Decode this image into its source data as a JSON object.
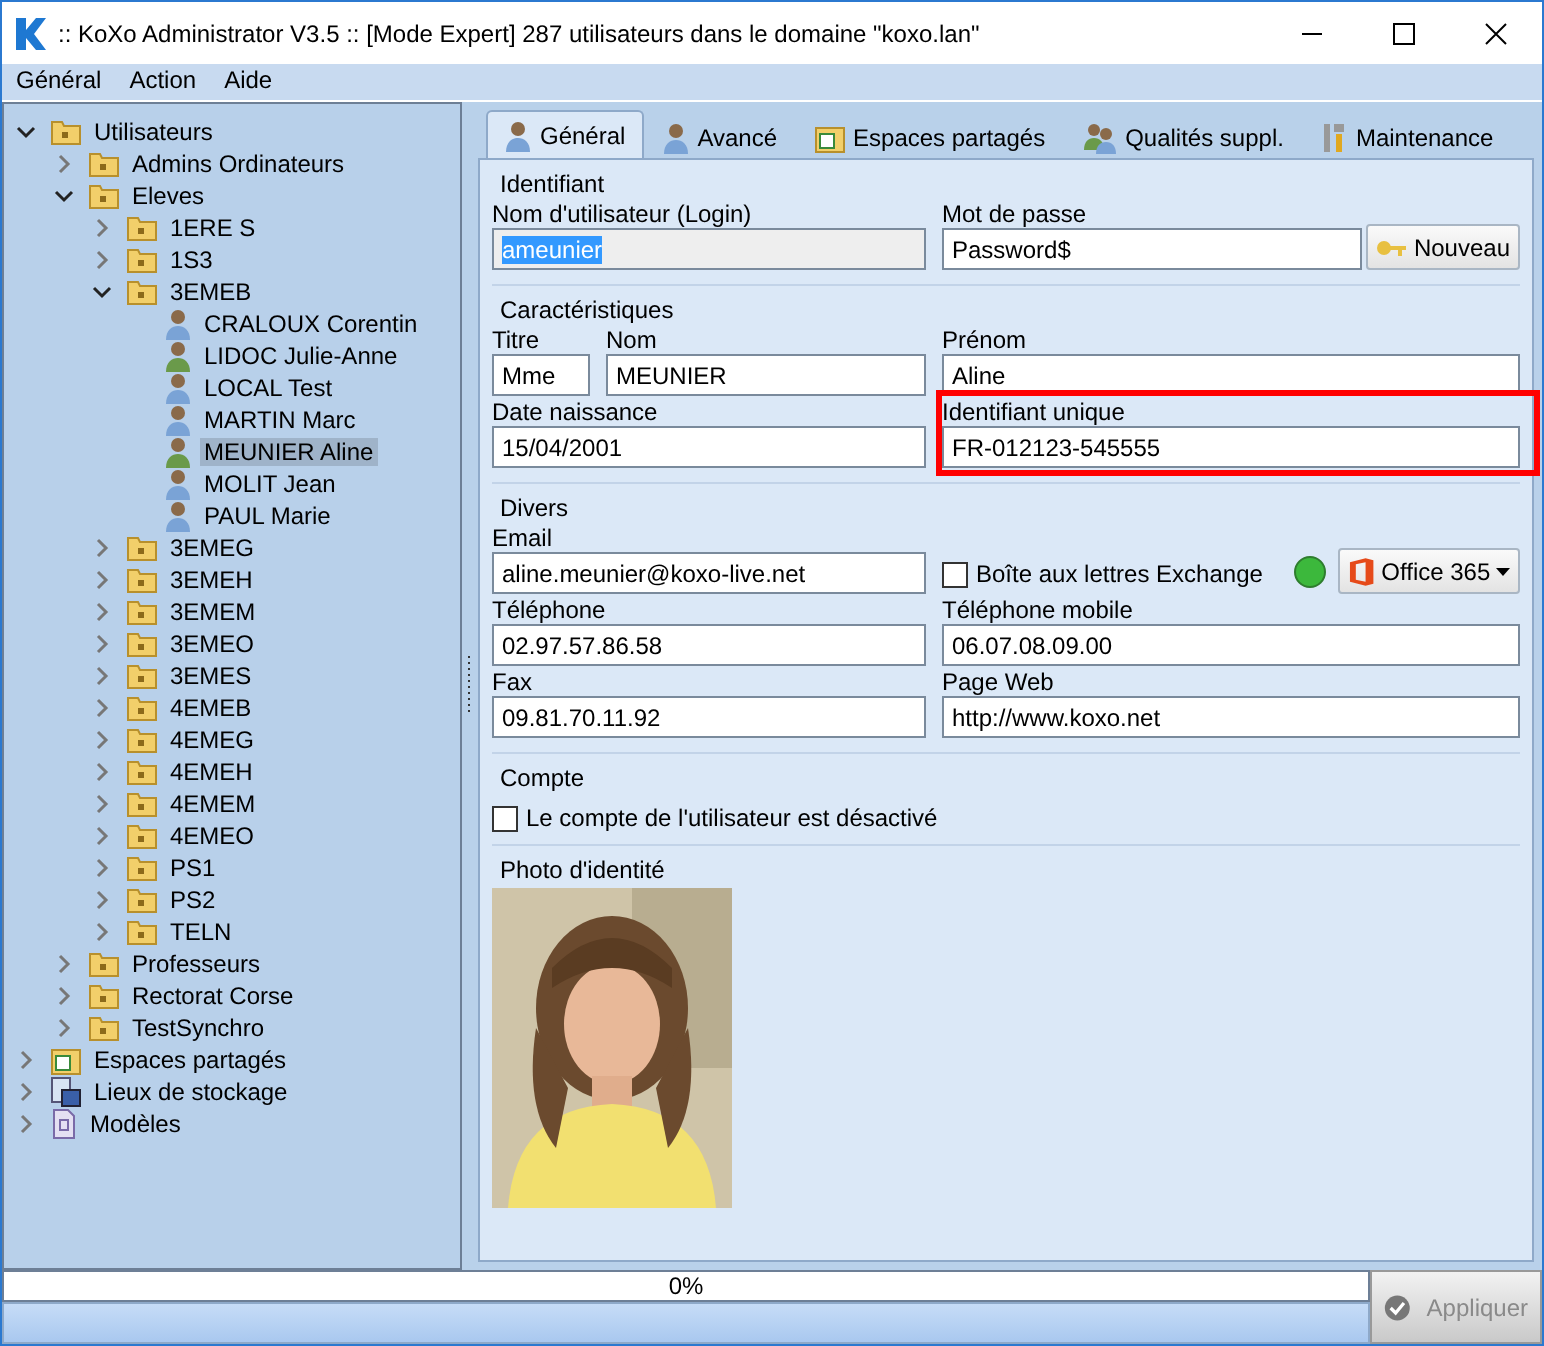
{
  "window": {
    "title": ":: KoXo Administrator V3.5 :: [Mode Expert] 287 utilisateurs dans le domaine \"koxo.lan\""
  },
  "menu": [
    {
      "label": "Général"
    },
    {
      "label": "Action"
    },
    {
      "label": "Aide"
    }
  ],
  "tree": [
    {
      "label": "Utilisateurs",
      "kind": "folder",
      "expanded": true,
      "selected": false,
      "children": [
        {
          "label": "Admins Ordinateurs",
          "kind": "folder",
          "expanded": false,
          "selected": false
        },
        {
          "label": "Eleves",
          "kind": "folder",
          "expanded": true,
          "selected": false,
          "children": [
            {
              "label": "1ERE S",
              "kind": "folder",
              "expanded": false,
              "selected": false
            },
            {
              "label": "1S3",
              "kind": "folder",
              "expanded": false,
              "selected": false
            },
            {
              "label": "3EMEB",
              "kind": "folder",
              "expanded": true,
              "selected": false,
              "children": [
                {
                  "label": "CRALOUX Corentin",
                  "kind": "user_male",
                  "selected": false
                },
                {
                  "label": "LIDOC Julie-Anne",
                  "kind": "user_female",
                  "selected": false
                },
                {
                  "label": "LOCAL Test",
                  "kind": "user_male",
                  "selected": false
                },
                {
                  "label": "MARTIN Marc",
                  "kind": "user_male",
                  "selected": false
                },
                {
                  "label": "MEUNIER Aline",
                  "kind": "user_female",
                  "selected": true
                },
                {
                  "label": "MOLIT Jean",
                  "kind": "user_male",
                  "selected": false
                },
                {
                  "label": "PAUL Marie",
                  "kind": "user_male",
                  "selected": false
                }
              ]
            },
            {
              "label": "3EMEG",
              "kind": "folder",
              "expanded": false,
              "selected": false
            },
            {
              "label": "3EMEH",
              "kind": "folder",
              "expanded": false,
              "selected": false
            },
            {
              "label": "3EMEM",
              "kind": "folder",
              "expanded": false,
              "selected": false
            },
            {
              "label": "3EMEO",
              "kind": "folder",
              "expanded": false,
              "selected": false
            },
            {
              "label": "3EMES",
              "kind": "folder",
              "expanded": false,
              "selected": false
            },
            {
              "label": "4EMEB",
              "kind": "folder",
              "expanded": false,
              "selected": false
            },
            {
              "label": "4EMEG",
              "kind": "folder",
              "expanded": false,
              "selected": false
            },
            {
              "label": "4EMEH",
              "kind": "folder",
              "expanded": false,
              "selected": false
            },
            {
              "label": "4EMEM",
              "kind": "folder",
              "expanded": false,
              "selected": false
            },
            {
              "label": "4EMEO",
              "kind": "folder",
              "expanded": false,
              "selected": false
            },
            {
              "label": "PS1",
              "kind": "folder",
              "expanded": false,
              "selected": false
            },
            {
              "label": "PS2",
              "kind": "folder",
              "expanded": false,
              "selected": false
            },
            {
              "label": "TELN",
              "kind": "folder",
              "expanded": false,
              "selected": false
            }
          ]
        },
        {
          "label": "Professeurs",
          "kind": "folder",
          "expanded": false,
          "selected": false
        },
        {
          "label": "Rectorat Corse",
          "kind": "folder",
          "expanded": false,
          "selected": false
        },
        {
          "label": "TestSynchro",
          "kind": "folder",
          "expanded": false,
          "selected": false
        }
      ]
    },
    {
      "label": "Espaces partagés",
      "kind": "shares",
      "expanded": false,
      "selected": false
    },
    {
      "label": "Lieux de stockage",
      "kind": "storage",
      "expanded": false,
      "selected": false
    },
    {
      "label": "Modèles",
      "kind": "templates",
      "expanded": false,
      "selected": false
    }
  ],
  "tabs": [
    {
      "label": "Général",
      "kind": "user",
      "selected": true
    },
    {
      "label": "Avancé",
      "kind": "user",
      "selected": false
    },
    {
      "label": "Espaces partagés",
      "kind": "shares",
      "selected": false
    },
    {
      "label": "Qualités suppl.",
      "kind": "users",
      "selected": false
    },
    {
      "label": "Maintenance",
      "kind": "tools",
      "selected": false
    }
  ],
  "identifiant": {
    "title": "Identifiant",
    "login": {
      "label": "Nom d'utilisateur (Login)",
      "value": "ameunier",
      "disabled": true,
      "selected": true
    },
    "password": {
      "label": "Mot de passe",
      "value": "Password$"
    },
    "new_button": "Nouveau"
  },
  "caracteristiques": {
    "title": "Caractéristiques",
    "titre": {
      "label": "Titre",
      "value": "Mme"
    },
    "nom": {
      "label": "Nom",
      "value": "MEUNIER"
    },
    "prenom": {
      "label": "Prénom",
      "value": "Aline"
    },
    "naissance": {
      "label": "Date naissance",
      "value": "15/04/2001"
    },
    "identifiant_unique": {
      "label": "Identifiant unique",
      "value": "FR-012123-545555",
      "highlighted": true
    }
  },
  "divers": {
    "title": "Divers",
    "email": {
      "label": "Email",
      "value": "aline.meunier@koxo-live.net"
    },
    "exchange": {
      "label": "Boîte aux lettres Exchange",
      "checked": false
    },
    "status_dot": {
      "color": "#3cb83c"
    },
    "office": {
      "label": "Office 365"
    },
    "telephone": {
      "label": "Téléphone",
      "value": "02.97.57.86.58"
    },
    "mobile": {
      "label": "Téléphone mobile",
      "value": "06.07.08.09.00"
    },
    "fax": {
      "label": "Fax",
      "value": "09.81.70.11.92"
    },
    "web": {
      "label": "Page Web",
      "value": "http://www.koxo.net"
    }
  },
  "compte": {
    "title": "Compte",
    "disabled_account": {
      "label": "Le compte de l'utilisateur est désactivé",
      "checked": false
    }
  },
  "photo": {
    "title": "Photo d'identité",
    "kind": "picture"
  },
  "progress": {
    "text": "0%",
    "level": 0
  },
  "apply_button": {
    "label": "Appliquer",
    "disabled": true
  }
}
